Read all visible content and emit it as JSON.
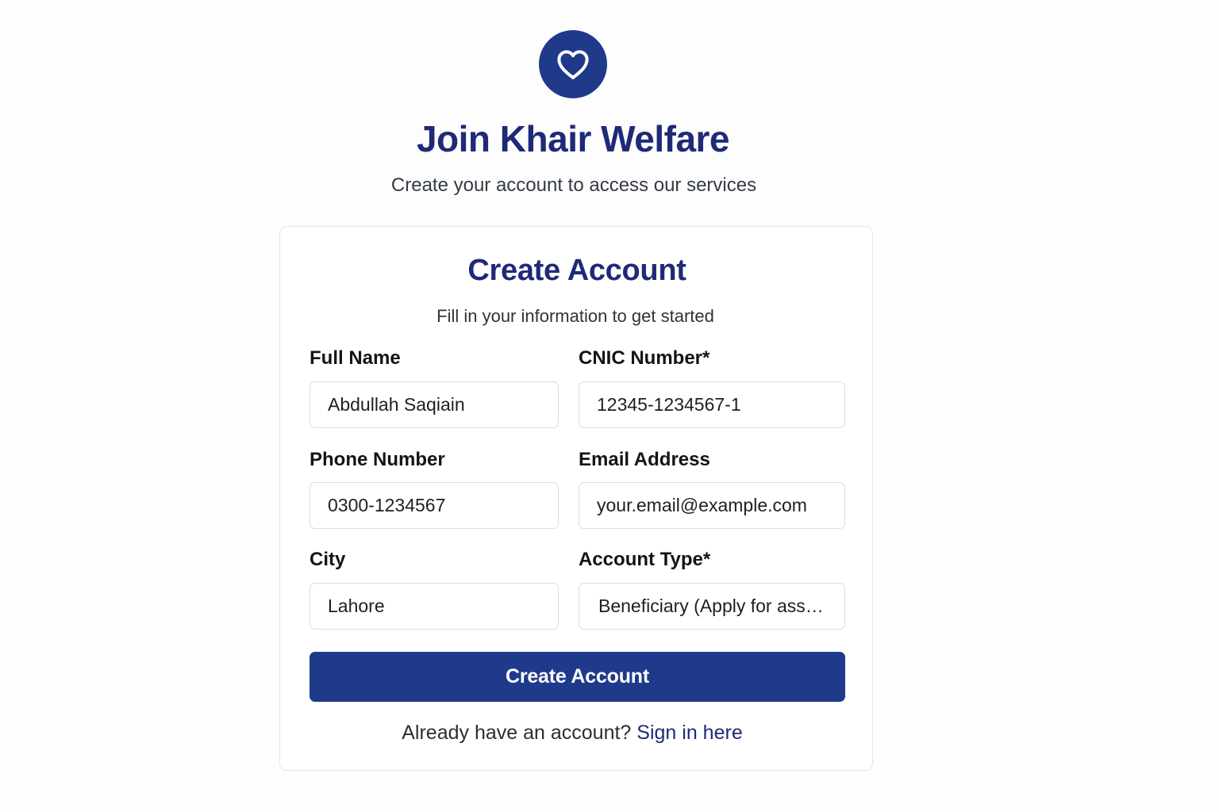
{
  "header": {
    "logo_icon": "heart-icon",
    "title": "Join Khair Welfare",
    "subtitle": "Create your account to access our services"
  },
  "form": {
    "title": "Create Account",
    "subtitle": "Fill in your information to get started",
    "fields": {
      "full_name": {
        "label": "Full Name",
        "value": "Abdullah Saqiain"
      },
      "cnic": {
        "label": "CNIC Number*",
        "value": "12345-1234567-1"
      },
      "phone": {
        "label": "Phone Number",
        "value": "0300-1234567"
      },
      "email": {
        "label": "Email Address",
        "placeholder": "your.email@example.com"
      },
      "city": {
        "label": "City",
        "value": "Lahore"
      },
      "account_type": {
        "label": "Account Type*",
        "selected": "Beneficiary (Apply for assistance)"
      }
    },
    "submit_label": "Create Account",
    "signin_prompt": "Already have an account? ",
    "signin_link": "Sign in here"
  },
  "colors": {
    "primary": "#1f3a8a",
    "heading": "#1e2a78",
    "background": "#fdfdfe"
  }
}
